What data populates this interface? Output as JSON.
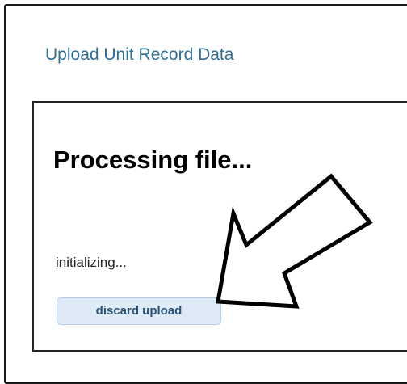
{
  "header": {
    "title": "Upload Unit Record Data"
  },
  "panel": {
    "heading": "Processing file...",
    "status": "initializing...",
    "discard_label": "discard upload"
  },
  "icons": {
    "annotation": "arrow-pointing-down-left-icon"
  },
  "colors": {
    "title": "#2f6f96",
    "button_bg": "#deeaf6",
    "button_text": "#2b5478"
  }
}
